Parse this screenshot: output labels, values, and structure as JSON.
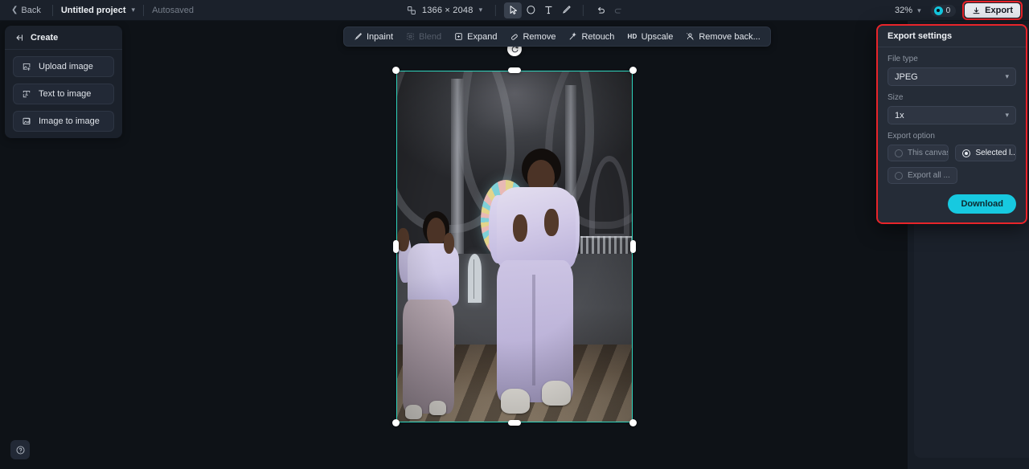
{
  "topbar": {
    "back_label": "Back",
    "project_name": "Untitled project",
    "autosave_status": "Autosaved",
    "canvas_dimensions": "1366 × 2048",
    "zoom_level": "32%",
    "credits_count": "0",
    "export_label": "Export",
    "tools": [
      {
        "name": "select-tool",
        "icon": "cursor-arrow-icon",
        "active": true
      },
      {
        "name": "shape-tool",
        "icon": "blob-shape-icon",
        "active": false
      },
      {
        "name": "text-tool",
        "icon": "text-T-icon",
        "active": false
      },
      {
        "name": "brush-tool",
        "icon": "paintbrush-icon",
        "active": false
      },
      {
        "name": "undo",
        "icon": "undo-arrow-icon",
        "active": false
      },
      {
        "name": "redo",
        "icon": "redo-arrow-icon",
        "active": false
      }
    ]
  },
  "left_panel": {
    "header_title": "Create",
    "items": [
      {
        "label": "Upload image",
        "icon": "upload-image-icon"
      },
      {
        "label": "Text to image",
        "icon": "text-to-image-icon"
      },
      {
        "label": "Image to image",
        "icon": "image-to-image-icon"
      }
    ]
  },
  "canvas_toolbar": {
    "items": [
      {
        "label": "Inpaint",
        "icon": "inpaint-brush-icon",
        "disabled": false
      },
      {
        "label": "Blend",
        "icon": "blend-icon",
        "disabled": true
      },
      {
        "label": "Expand",
        "icon": "expand-icon",
        "disabled": false
      },
      {
        "label": "Remove",
        "icon": "eraser-icon",
        "disabled": false
      },
      {
        "label": "Retouch",
        "icon": "retouch-wand-icon",
        "disabled": false
      },
      {
        "label": "Upscale",
        "icon": "hd-badge-icon",
        "disabled": false
      },
      {
        "label": "Remove back...",
        "icon": "remove-background-icon",
        "disabled": false
      }
    ]
  },
  "artwork": {
    "description": "Two young dancers in lavender sweatsuits inside a bright cathedral with a rose stained-glass window"
  },
  "export_panel": {
    "title": "Export settings",
    "file_type_label": "File type",
    "file_type_value": "JPEG",
    "size_label": "Size",
    "size_value": "1x",
    "export_option_label": "Export option",
    "options": [
      {
        "label": "This canvas",
        "selected": false
      },
      {
        "label": "Selected l...",
        "selected": true
      },
      {
        "label": "Export all ...",
        "selected": false
      }
    ],
    "download_label": "Download",
    "highlight_color": "#e8242a",
    "accent_color": "#17c9e0"
  },
  "help": {
    "icon": "question-mark-circle-icon"
  }
}
